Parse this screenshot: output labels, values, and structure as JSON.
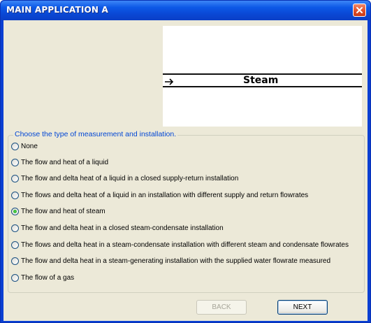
{
  "window": {
    "title": "MAIN APPLICATION A",
    "close_icon": "close-icon",
    "title_color": "#0c58e6",
    "close_color": "#e2532d"
  },
  "preview": {
    "label": "Steam",
    "arrow_icon": "arrow-right-icon"
  },
  "group": {
    "legend": "Choose the type of measurement and installation.",
    "legend_color": "#0046d5",
    "options": [
      {
        "label": "None",
        "selected": false
      },
      {
        "label": "The flow and heat of a liquid",
        "selected": false
      },
      {
        "label": "The flow and delta heat of a liquid in a closed supply-return installation",
        "selected": false
      },
      {
        "label": "The flows and delta heat of a liquid in an installation with different supply and return flowrates",
        "selected": false
      },
      {
        "label": "The flow and heat of steam",
        "selected": true
      },
      {
        "label": "The flow and delta heat in a closed steam-condensate installation",
        "selected": false
      },
      {
        "label": "The flows and delta heat in a steam-condensate installation with different steam and condensate flowrates",
        "selected": false
      },
      {
        "label": "The flow and delta heat in a steam-generating installation with the supplied water flowrate measured",
        "selected": false
      },
      {
        "label": "The flow of a gas",
        "selected": false
      }
    ]
  },
  "buttons": {
    "back_label": "BACK",
    "back_enabled": false,
    "next_label": "NEXT"
  }
}
